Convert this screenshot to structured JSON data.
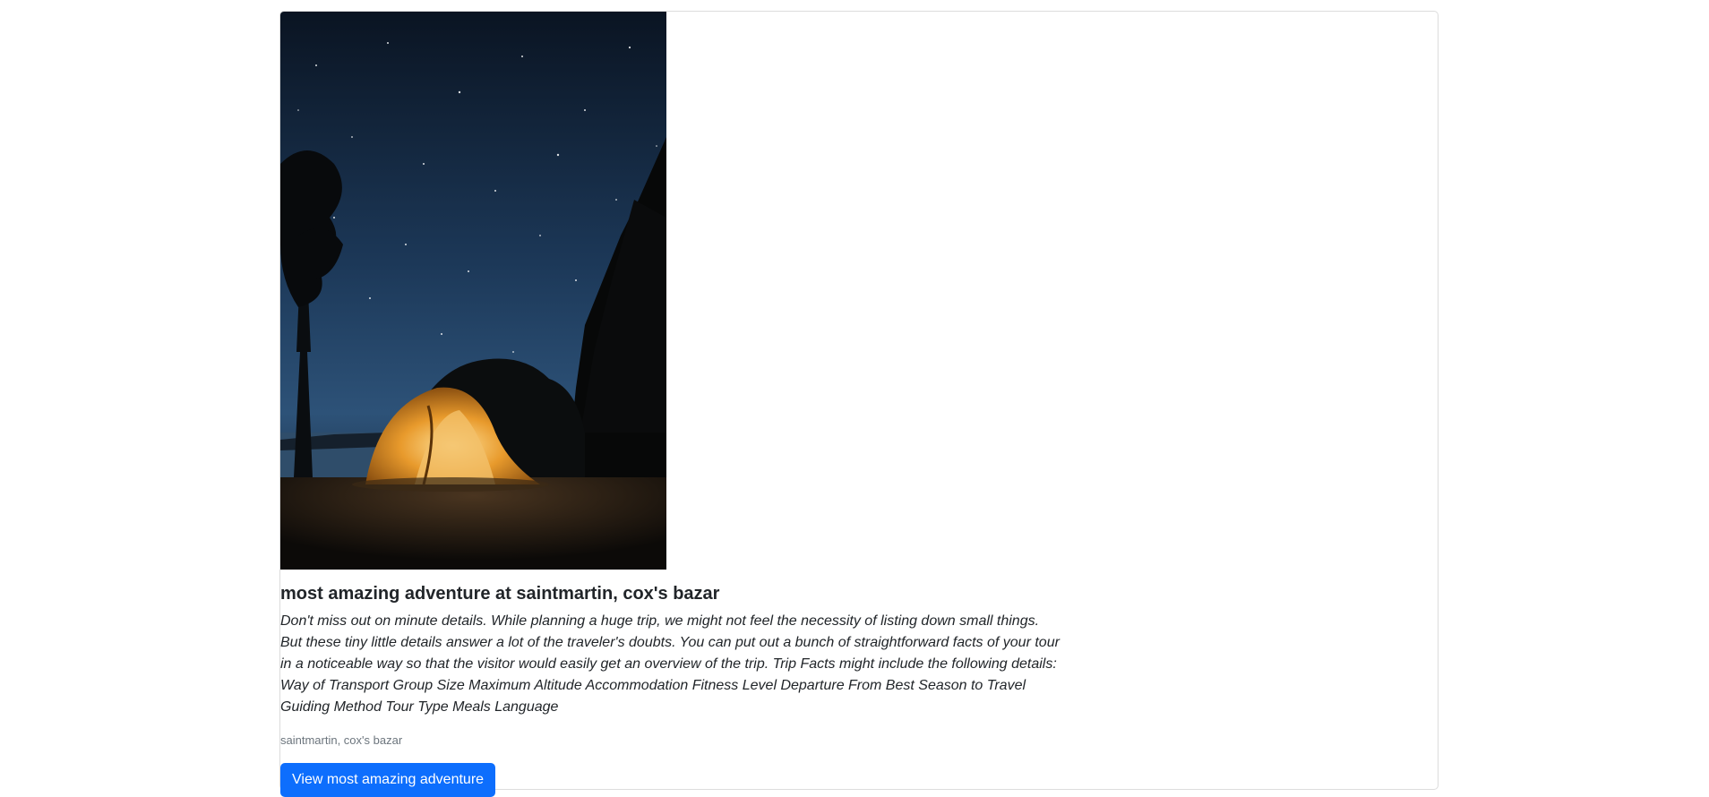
{
  "card": {
    "image": {
      "alt_icon": "camping-tent-night-photo"
    },
    "title": "most amazing adventure at saintmartin, cox's bazar",
    "description": "Don't miss out on minute details. While planning a huge trip, we might not feel the necessity of listing down small things. But these tiny little details answer a lot of the traveler's doubts. You can put out a bunch of straightforward facts of your tour in a noticeable way so that the visitor would easily get an overview of the trip. Trip Facts might include the following details: Way of Transport Group Size Maximum Altitude Accommodation Fitness Level Departure From Best Season to Travel Guiding Method Tour Type Meals Language",
    "location": "saintmartin, cox's bazar",
    "button_label": "View most amazing adventure"
  },
  "colors": {
    "primary": "#0d6efd",
    "muted": "#6c757d",
    "border": "#dcdcdc",
    "sky_top": "#0b1626",
    "sky_bottom": "#2a4c72",
    "tent": "#e79a2e"
  }
}
